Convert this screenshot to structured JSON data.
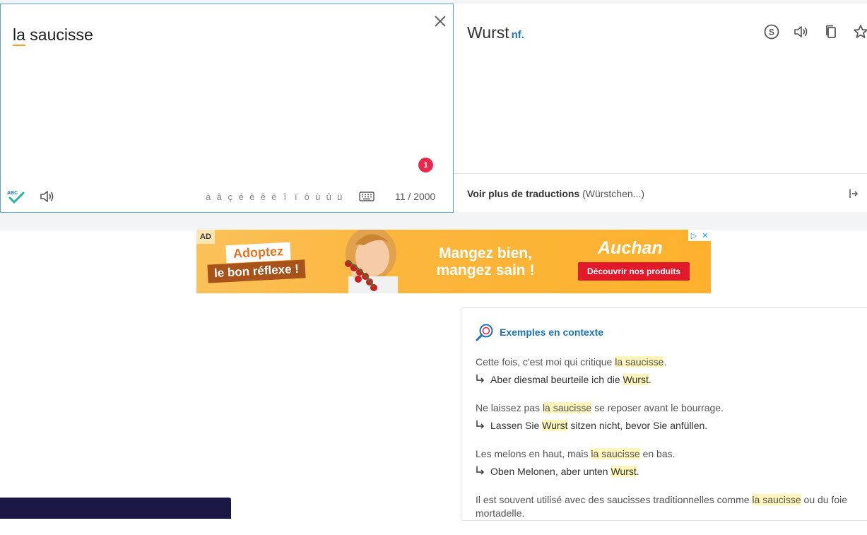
{
  "source": {
    "text_part1": "la",
    "text_part2": " saucisse",
    "error_count": "1",
    "accents": [
      "à",
      "â",
      "ç",
      "é",
      "è",
      "ê",
      "ë",
      "î",
      "ï",
      "ô",
      "ù",
      "û",
      "ü"
    ],
    "char_count": "11 / 2000",
    "spellcheck_label": "ABC"
  },
  "target": {
    "word": "Wurst",
    "pos": "nf.",
    "more_translations_label": "Voir plus de traductions",
    "more_translations_preview": "(Würstchen...)"
  },
  "ad": {
    "tag": "AD",
    "line1": "Adoptez",
    "line2": "le bon réflexe !",
    "slogan": "Mangez bien, mangez sain !",
    "brand": "Auchan",
    "cta": "Découvrir nos produits"
  },
  "examples": {
    "title": "Exemples en contexte",
    "items": [
      {
        "src_before": "Cette fois, c'est moi qui critique ",
        "src_hl": "la saucisse",
        "src_after": ".",
        "tgt_before": "Aber diesmal beurteile ich die ",
        "tgt_hl": "Wurst",
        "tgt_after": "."
      },
      {
        "src_before": "Ne laissez pas ",
        "src_hl": "la saucisse",
        "src_after": " se reposer avant le bourrage.",
        "tgt_before": "Lassen Sie ",
        "tgt_hl": "Wurst",
        "tgt_after": " sitzen nicht, bevor Sie anfüllen."
      },
      {
        "src_before": "Les melons en haut, mais ",
        "src_hl": "la saucisse",
        "src_after": " en bas.",
        "tgt_before": "Oben Melonen, aber unten ",
        "tgt_hl": "Wurst",
        "tgt_after": "."
      },
      {
        "src_before": "Il est souvent utilisé avec des saucisses traditionnelles comme ",
        "src_hl": "la saucisse",
        "src_after": " ou du foie mortadelle.",
        "tgt_before": "",
        "tgt_hl": "",
        "tgt_after": ""
      }
    ]
  },
  "colors": {
    "accent": "#1c74b7",
    "highlight": "#fdf5b9",
    "badge": "#e8294d",
    "spell": "#2bb4a0"
  }
}
